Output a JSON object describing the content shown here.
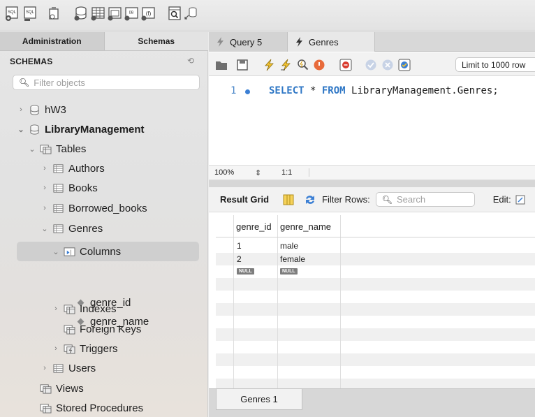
{
  "left_tabs": [
    "Administration",
    "Schemas"
  ],
  "schemas": {
    "header": "SCHEMAS",
    "filter_placeholder": "Filter objects",
    "tree": [
      {
        "label": "hW3"
      },
      {
        "label": "LibraryManagement"
      },
      {
        "label": "Tables"
      },
      {
        "label": "Authors"
      },
      {
        "label": "Books"
      },
      {
        "label": "Borrowed_books"
      },
      {
        "label": "Genres"
      },
      {
        "label": "Columns"
      },
      {
        "label": "genre_id"
      },
      {
        "label": "genre_name"
      },
      {
        "label": "Indexes"
      },
      {
        "label": "Foreign Keys"
      },
      {
        "label": "Triggers"
      },
      {
        "label": "Users"
      },
      {
        "label": "Views"
      },
      {
        "label": "Stored Procedures"
      }
    ]
  },
  "query_tabs": [
    "Query 5",
    "Genres"
  ],
  "sql_toolbar": {
    "limit_label": "Limit to 1000 row"
  },
  "editor": {
    "line_number": "1",
    "kw_select": "SELECT",
    "star": " * ",
    "kw_from": "FROM",
    "target": " LibraryManagement.Genres;"
  },
  "editor_status": {
    "zoom": "100%",
    "cursor": "1:1"
  },
  "result_bar": {
    "label": "Result Grid",
    "filter_label": "Filter Rows:",
    "search_placeholder": "Search",
    "edit_label": "Edit:"
  },
  "grid": {
    "columns": [
      "genre_id",
      "genre_name"
    ],
    "rows": [
      [
        "1",
        "male"
      ],
      [
        "2",
        "female"
      ]
    ],
    "null_row": [
      "NULL",
      "NULL"
    ]
  },
  "bottom_tab": "Genres 1",
  "colors": {
    "keyword": "#2f77c5",
    "selection": "#cfcfcf",
    "accent": "#3b7fd4"
  }
}
